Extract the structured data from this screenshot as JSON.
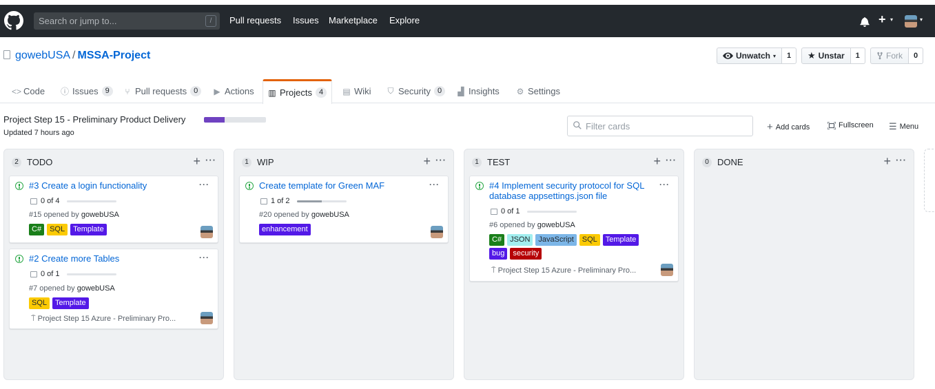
{
  "header": {
    "search_placeholder": "Search or jump to...",
    "search_shortcut": "/",
    "nav": [
      "Pull requests",
      "Issues",
      "Marketplace",
      "Explore"
    ],
    "icons": [
      "github-logo",
      "bell-icon",
      "plus-icon",
      "avatar"
    ]
  },
  "repo": {
    "owner": "gowebUSA",
    "separator": "/",
    "name": "MSSA-Project",
    "unwatch_label": "Unwatch",
    "watch_count": "1",
    "unstar_label": "Unstar",
    "star_count": "1",
    "fork_label": "Fork",
    "fork_count": "0"
  },
  "tabs": [
    {
      "label": "Code",
      "count": "",
      "icon": "code-icon"
    },
    {
      "label": "Issues",
      "count": "9",
      "icon": "issue-icon"
    },
    {
      "label": "Pull requests",
      "count": "0",
      "icon": "pr-icon"
    },
    {
      "label": "Actions",
      "count": "",
      "icon": "play-icon"
    },
    {
      "label": "Projects",
      "count": "4",
      "icon": "project-icon"
    },
    {
      "label": "Wiki",
      "count": "",
      "icon": "book-icon"
    },
    {
      "label": "Security",
      "count": "0",
      "icon": "shield-icon"
    },
    {
      "label": "Insights",
      "count": "",
      "icon": "graph-icon"
    },
    {
      "label": "Settings",
      "count": "",
      "icon": "gear-icon"
    }
  ],
  "project": {
    "title": "Project Step 15 - Preliminary Product Delivery",
    "progress": 0.33,
    "progress_color": "#6f42c1",
    "updated": "Updated 7 hours ago",
    "filter_placeholder": "Filter cards",
    "add_cards": "Add cards",
    "fullscreen": "Fullscreen",
    "menu": "Menu"
  },
  "columns": [
    {
      "count": "2",
      "name": "TODO",
      "cards": [
        {
          "title": "#3 Create a login functionality",
          "tasks": "0 of 4",
          "task_progress": 0,
          "meta_prefix": "#15 opened by",
          "author": "gowebUSA",
          "labels": [
            {
              "text": "C#",
              "bg": "#1a7f1a",
              "fg": "#ffffff"
            },
            {
              "text": "SQL",
              "bg": "#fbca04",
              "fg": "#24292e"
            },
            {
              "text": "Template",
              "bg": "#5319e7",
              "fg": "#ffffff"
            }
          ],
          "milestone": ""
        },
        {
          "title": "#2 Create more Tables",
          "tasks": "0 of 1",
          "task_progress": 0,
          "meta_prefix": "#7 opened by",
          "author": "gowebUSA",
          "labels": [
            {
              "text": "SQL",
              "bg": "#fbca04",
              "fg": "#24292e"
            },
            {
              "text": "Template",
              "bg": "#5319e7",
              "fg": "#ffffff"
            }
          ],
          "milestone": "Project Step 15 Azure - Preliminary Pro..."
        }
      ]
    },
    {
      "count": "1",
      "name": "WIP",
      "cards": [
        {
          "title": "Create template for Green MAF",
          "tasks": "1 of 2",
          "task_progress": 0.5,
          "meta_prefix": "#20 opened by",
          "author": "gowebUSA",
          "labels": [
            {
              "text": "enhancement",
              "bg": "#5319e7",
              "fg": "#ffffff"
            }
          ],
          "milestone": ""
        }
      ]
    },
    {
      "count": "1",
      "name": "TEST",
      "cards": [
        {
          "title": "#4 Implement security protocol for SQL database appsettings.json file",
          "tasks": "0 of 1",
          "task_progress": 0,
          "meta_prefix": "#6 opened by",
          "author": "gowebUSA",
          "labels": [
            {
              "text": "C#",
              "bg": "#1a7f1a",
              "fg": "#ffffff"
            },
            {
              "text": "JSON",
              "bg": "#a2eeef",
              "fg": "#24292e"
            },
            {
              "text": "JavaScript",
              "bg": "#7cb6e8",
              "fg": "#24292e"
            },
            {
              "text": "SQL",
              "bg": "#fbca04",
              "fg": "#24292e"
            },
            {
              "text": "Template",
              "bg": "#5319e7",
              "fg": "#ffffff"
            },
            {
              "text": "bug",
              "bg": "#5319e7",
              "fg": "#ffffff"
            },
            {
              "text": "security",
              "bg": "#b60205",
              "fg": "#ffffff"
            }
          ],
          "milestone": "Project Step 15 Azure - Preliminary Pro..."
        }
      ]
    },
    {
      "count": "0",
      "name": "DONE",
      "cards": []
    }
  ]
}
